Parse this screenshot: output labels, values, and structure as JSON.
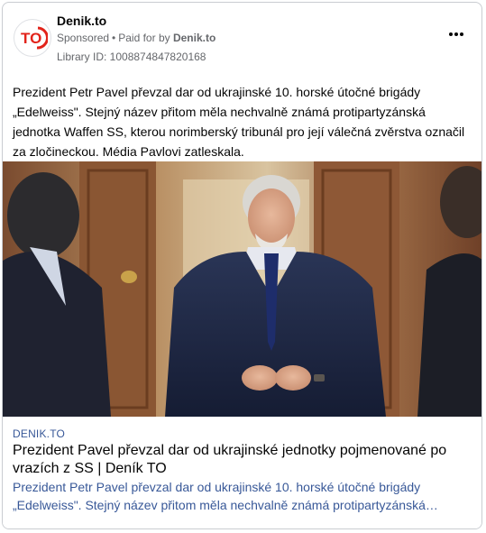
{
  "post": {
    "page_name": "Denik.to",
    "sponsored_label": "Sponsored",
    "paid_for_prefix": "Paid for by",
    "paid_for_name": "Denik.to",
    "library_id": "Library ID: 1008874847820168",
    "logo_text": "TO",
    "body_text": "Prezident Petr Pavel převzal dar od ukrajinské 10. horské útočné brigády „Edelweiss\". Stejný název přitom měla nechvalně známá protipartyzánská jednotka Waffen SS, kterou norimberský tribunál pro její válečná zvěrstva označil za zločineckou. Média Pavlovi zatleskala."
  },
  "link_preview": {
    "domain": "DENIK.TO",
    "title": "Prezident Pavel převzal dar od ukrajinské jednotky pojmenované po vrazích z SS | Deník TO",
    "description": "Prezident Petr Pavel převzal dar od ukrajinské 10. horské útočné brigády „Edelweiss\". Stejný název přitom měla nechvalně známá protipartyzánská…"
  },
  "icons": {
    "more": "more-options-icon",
    "logo": "denik-to-logo"
  },
  "colors": {
    "logo_red": "#e2231a",
    "link_blue": "#385898",
    "meta_gray": "#65676b"
  }
}
